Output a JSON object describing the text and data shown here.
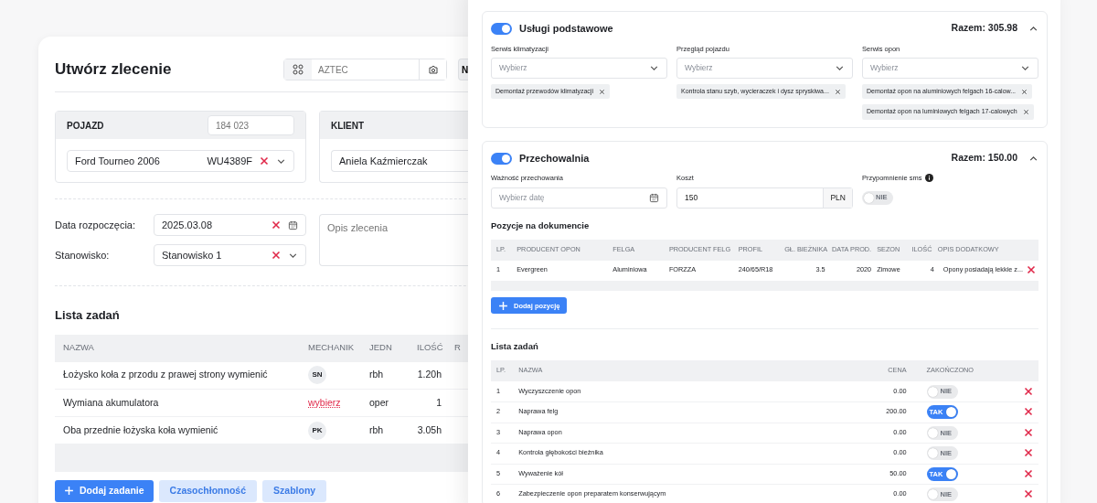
{
  "order": {
    "title": "Utwórz zlecenie",
    "code_field": {
      "placeholder": "AZTEC"
    },
    "n_button": "N",
    "vehicle": {
      "title": "POJAZD",
      "number_placeholder": "184 023",
      "model": "Ford Tourneo 2006",
      "plate": "WU4389F"
    },
    "client": {
      "title": "KLIENT",
      "name": "Aniela Kaźmierczak"
    },
    "start_date": {
      "label": "Data rozpoczęcia:",
      "value": "2025.03.08"
    },
    "station": {
      "label": "Stanowisko:",
      "value": "Stanowisko 1"
    },
    "description": {
      "placeholder": "Opis zlecenia"
    },
    "tasks": {
      "title": "Lista zadań",
      "columns": [
        "NAZWA",
        "MECHANIK",
        "JEDN",
        "ILOŚĆ",
        "R"
      ],
      "rows": [
        {
          "name": "Łożysko koła z przodu z prawej strony wymienić",
          "mechanic": {
            "kind": "avatar",
            "text": "SN"
          },
          "unit": "rbh",
          "qty": "1.20h"
        },
        {
          "name": "Wymiana akumulatora",
          "mechanic": {
            "kind": "link",
            "text": "wybierz"
          },
          "unit": "oper",
          "qty": "1"
        },
        {
          "name": "Oba przednie łożyska koła wymienić",
          "mechanic": {
            "kind": "avatar",
            "text": "PK"
          },
          "unit": "rbh",
          "qty": "3.05h"
        }
      ]
    },
    "buttons": [
      {
        "label": "Dodaj zadanie",
        "kind": "primary"
      },
      {
        "label": "Czasochłonność",
        "kind": "light"
      },
      {
        "label": "Szablony",
        "kind": "light"
      }
    ]
  },
  "basic_services": {
    "enabled": true,
    "title": "Usługi podstawowe",
    "total": "Razem: 305.98",
    "expanded": true,
    "selects": [
      {
        "label": "Serwis klimatyzacji",
        "placeholder": "Wybierz",
        "tags": [
          "Demontaż przewodów klimatyzacji"
        ]
      },
      {
        "label": "Przegląd pojazdu",
        "placeholder": "Wybierz",
        "tags": [
          "Kontrola stanu szyb, wycieraczek i dysz spryskiwa..."
        ]
      },
      {
        "label": "Serwis opon",
        "placeholder": "Wybierz",
        "tags": [
          "Demontaż opon na aluminiowych felgach 16-calow...",
          "Demontaż opon na luminiowych felgach 17-calowych"
        ]
      }
    ]
  },
  "storage": {
    "enabled": true,
    "title": "Przechowalnia",
    "total": "Razem: 150.00",
    "expanded": true,
    "validity": {
      "label": "Ważność przechowania",
      "placeholder": "Wybierz datę"
    },
    "cost": {
      "label": "Koszt",
      "value": "150",
      "currency": "PLN"
    },
    "sms": {
      "label": "Przypomnienie sms",
      "on": false,
      "text": "NIE"
    },
    "positions": {
      "title": "Pozycje na dokumencie",
      "columns": [
        "LP.",
        "PRODUCENT OPON",
        "FELGA",
        "PRODUCENT FELG",
        "PROFIL",
        "GŁ. BIEŻNIKA",
        "DATA PROD.",
        "SEZON",
        "ILOŚĆ",
        "OPIS DODATKOWY"
      ],
      "rows": [
        [
          "1",
          "Evergreen",
          "Aluminiowa",
          "FORZZA",
          "240/65/R18",
          "3.5",
          "2020",
          "Zimowe",
          "4",
          "Opony posiadają lekkie z..."
        ]
      ],
      "add_button": "Dodaj pozycję"
    },
    "tasks": {
      "title": "Lista zadań",
      "columns": [
        "LP.",
        "NAZWA",
        "CENA",
        "ZAKOŃCZONO"
      ],
      "rows": [
        {
          "lp": "1",
          "name": "Wyczyszczenie opon",
          "price": "0.00",
          "done": false,
          "toggle_text": "NIE"
        },
        {
          "lp": "2",
          "name": "Naprawa felg",
          "price": "200.00",
          "done": true,
          "toggle_text": "TAK"
        },
        {
          "lp": "3",
          "name": "Naprawa opon",
          "price": "0.00",
          "done": false,
          "toggle_text": "NIE"
        },
        {
          "lp": "4",
          "name": "Kontrola głębokości bieżnika",
          "price": "0.00",
          "done": false,
          "toggle_text": "NIE"
        },
        {
          "lp": "5",
          "name": "Wyważenie kół",
          "price": "50.00",
          "done": true,
          "toggle_text": "TAK"
        },
        {
          "lp": "6",
          "name": "Zabezpieczenie opon preparatem konserwującym",
          "price": "0.00",
          "done": false,
          "toggle_text": "NIE"
        }
      ]
    }
  }
}
